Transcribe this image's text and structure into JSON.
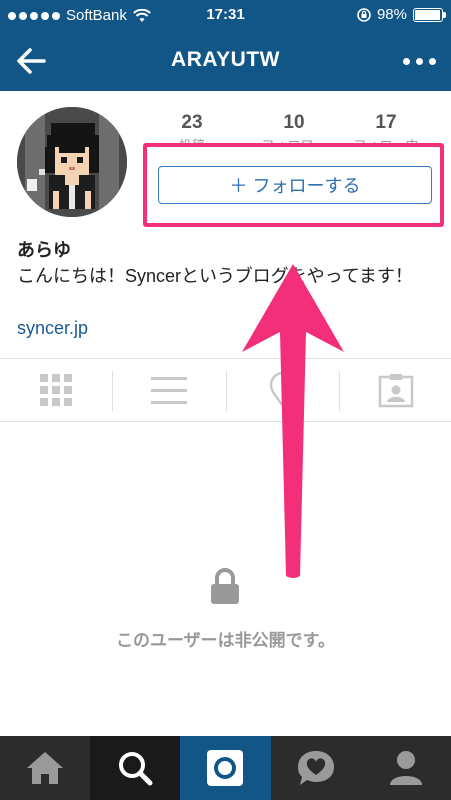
{
  "status": {
    "carrier": "SoftBank",
    "time": "17:31",
    "battery": "98%",
    "battery_level": 0.98
  },
  "nav": {
    "title": "ARAYUTW"
  },
  "profile": {
    "stats": [
      {
        "count": "23",
        "label": "投稿"
      },
      {
        "count": "10",
        "label": "フォロワー"
      },
      {
        "count": "17",
        "label": "フォロー中"
      }
    ],
    "follow_label": "＋ フォローする",
    "name": "あらゆ",
    "bio": "こんにちは！Syncerというブログをやってます！",
    "link": "syncer.jp"
  },
  "private_message": "このユーザーは非公開です。",
  "icons": {
    "back": "arrow-left-icon",
    "more": "more-dots-icon",
    "tabs": [
      "grid-icon",
      "list-icon",
      "map-pin-icon",
      "tagged-icon"
    ],
    "bottom": [
      "home-icon",
      "search-icon",
      "camera-icon",
      "activity-heart-icon",
      "profile-icon"
    ]
  },
  "colors": {
    "header": "#125688",
    "highlight": "#f22f78",
    "follow_button": "#3b7cc4"
  }
}
